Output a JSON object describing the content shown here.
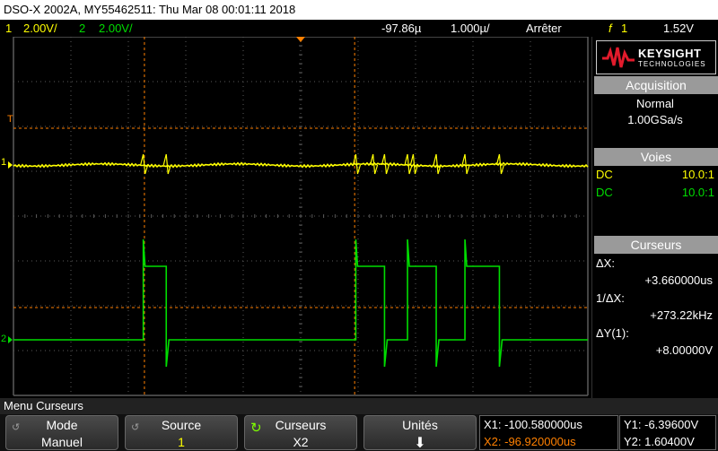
{
  "title": "DSO-X 2002A, MY55462511: Thu Mar 08 00:01:11 2018",
  "status": {
    "ch1_num": "1",
    "ch1_scale": "2.00V/",
    "ch2_num": "2",
    "ch2_scale": "2.00V/",
    "time_offset": "-97.86µ",
    "timebase": "1.000µ/",
    "run_state": "Arrêter",
    "trigger_slope": "f",
    "trigger_channel": "1",
    "trigger_level": "1.52V"
  },
  "colors": {
    "ch1": "#ffff00",
    "ch2": "#00dd00",
    "cursor": "#ff8000",
    "grid": "#5a5a5a"
  },
  "panel": {
    "brand": "KEYSIGHT",
    "brand_sub": "TECHNOLOGIES",
    "acquisition_title": "Acquisition",
    "acquisition_mode": "Normal",
    "sample_rate": "1.00GSa/s",
    "channels_title": "Voies",
    "ch1_coupling": "DC",
    "ch1_probe": "10.0:1",
    "ch2_coupling": "DC",
    "ch2_probe": "10.0:1",
    "cursors_title": "Curseurs",
    "dx_label": "ΔX:",
    "dx_value": "+3.660000us",
    "inv_dx_label": "1/ΔX:",
    "inv_dx_value": "+273.22kHz",
    "dy_label": "ΔY(1):",
    "dy_value": "+8.00000V"
  },
  "markers": {
    "trigger": "T",
    "ch1": "1",
    "ch2": "2"
  },
  "menu": {
    "title": "Menu Curseurs",
    "mode_label": "Mode",
    "mode_value": "Manuel",
    "source_label": "Source",
    "source_value": "1",
    "cursors_label": "Curseurs",
    "cursors_value": "X2",
    "units_label": "Unités",
    "x1": "X1: -100.580000us",
    "x2": "X2: -96.920000us",
    "y1": "Y1: -6.39600V",
    "y2": "Y2: 1.60400V"
  },
  "waveforms": {
    "ch2_pulses_us": [
      [
        -100.6,
        -100.2
      ],
      [
        -96.9,
        -96.4
      ],
      [
        -96.0,
        -95.5
      ],
      [
        -95.0,
        -94.4
      ]
    ],
    "ch1_glitches_us": [
      -100.6,
      -100.2,
      -96.9,
      -96.6,
      -96.4,
      -96.0,
      -95.9,
      -95.5,
      -95.0,
      -94.4
    ]
  }
}
